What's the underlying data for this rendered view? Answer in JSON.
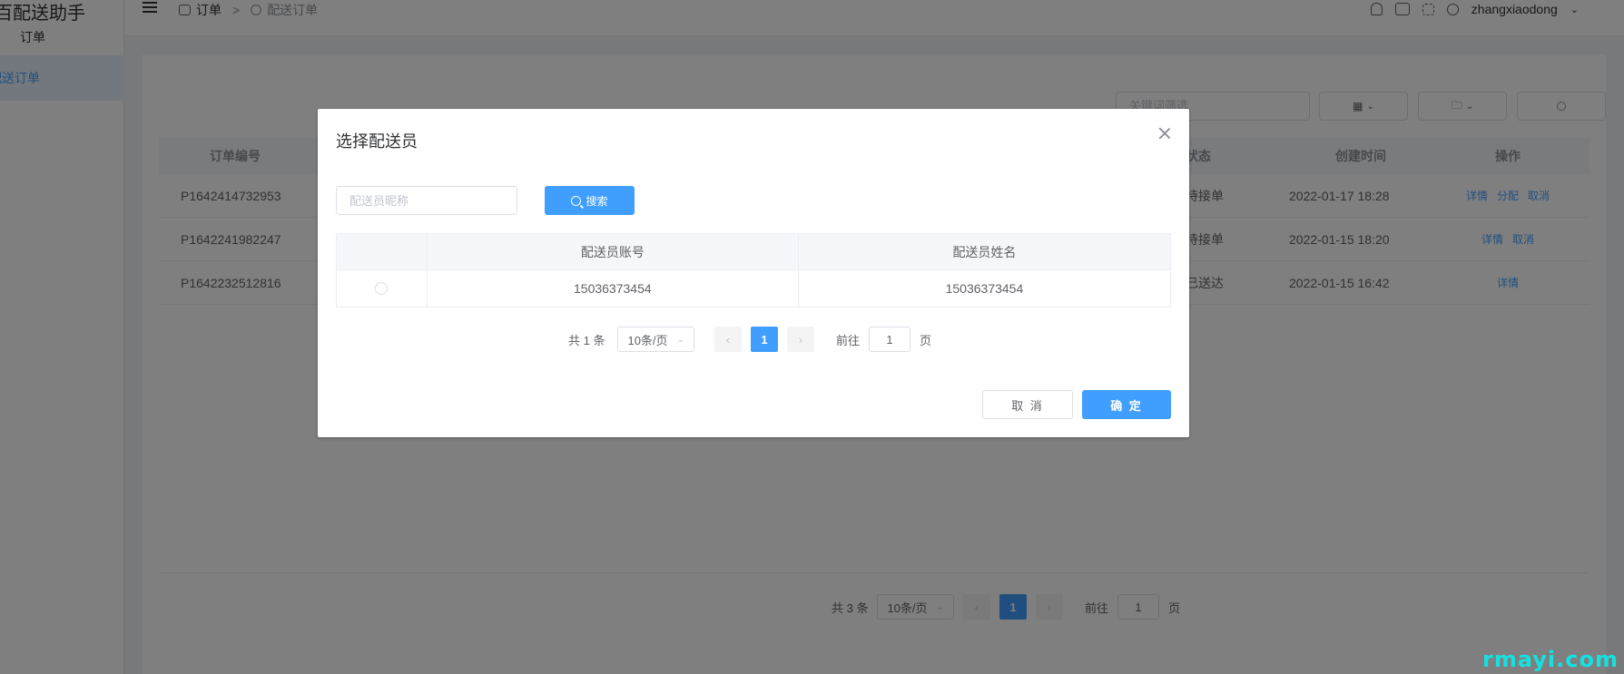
{
  "app": {
    "logo_text": "百配送助手",
    "menu_group": "订单",
    "menu_item": "配送订单"
  },
  "header": {
    "breadcrumb": [
      "订单",
      "配送订单"
    ],
    "username": "zhangxiaodong"
  },
  "filters": {
    "keyword_placeholder": "关键词筛选"
  },
  "orders_table": {
    "columns": [
      "订单编号",
      "状态",
      "创建时间",
      "操作"
    ],
    "rows": [
      {
        "id": "P1642414732953",
        "status": "待接单",
        "created": "2022-01-17 18:28",
        "ops": [
          "详情",
          "分配",
          "取消"
        ]
      },
      {
        "id": "P1642241982247",
        "status": "待接单",
        "created": "2022-01-15 18:20",
        "ops": [
          "详情",
          "取消"
        ]
      },
      {
        "id": "P1642232512816",
        "status": "已送达",
        "created": "2022-01-15 16:42",
        "ops": [
          "详情"
        ]
      }
    ]
  },
  "bg_pagination": {
    "total": "共 3 条",
    "page_size": "10条/页",
    "current_page": "1",
    "goto_label": "前往",
    "goto_value": "1",
    "page_suffix": "页"
  },
  "dialog": {
    "title": "选择配送员",
    "search_placeholder": "配送员昵称",
    "search_value": "",
    "search_button": "搜索",
    "columns": [
      "",
      "配送员账号",
      "配送员姓名"
    ],
    "rows": [
      {
        "account": "15036373454",
        "name": "15036373454"
      }
    ],
    "pagination": {
      "total": "共 1 条",
      "page_size": "10条/页",
      "current_page": "1",
      "goto_label": "前往",
      "goto_value": "1",
      "page_suffix": "页"
    },
    "cancel_label": "取 消",
    "confirm_label": "确 定"
  },
  "watermark": "rmayi.com",
  "colors": {
    "primary": "#409eff",
    "overlay": "rgba(0,0,0,0.5)",
    "watermark": "#16e0e0"
  }
}
